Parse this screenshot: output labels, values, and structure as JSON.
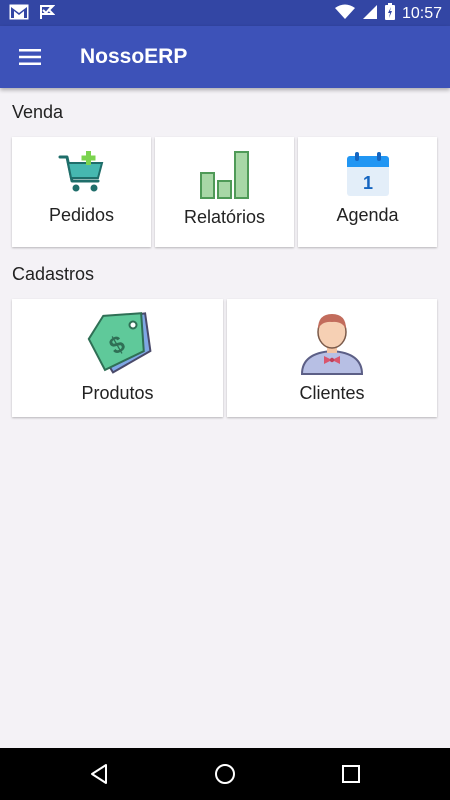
{
  "status_bar": {
    "time": "10:57",
    "icons": [
      "gmail-icon",
      "notification-flag-icon",
      "wifi-icon",
      "cellular-signal-icon",
      "battery-icon"
    ]
  },
  "app_bar": {
    "title": "NossoERP",
    "menu_icon": "hamburger-menu-icon",
    "color": "#3d52b8"
  },
  "sections": [
    {
      "title": "Venda",
      "items": [
        {
          "label": "Pedidos",
          "icon": "shopping-cart-add-icon"
        },
        {
          "label": "Relatórios",
          "icon": "bar-chart-icon"
        },
        {
          "label": "Agenda",
          "icon": "calendar-icon",
          "icon_text": "1"
        }
      ]
    },
    {
      "title": "Cadastros",
      "items": [
        {
          "label": "Produtos",
          "icon": "price-tag-icon"
        },
        {
          "label": "Clientes",
          "icon": "person-bowtie-icon"
        }
      ]
    }
  ],
  "nav_bar": {
    "icons": [
      "back-icon",
      "home-icon",
      "recent-apps-icon"
    ]
  }
}
